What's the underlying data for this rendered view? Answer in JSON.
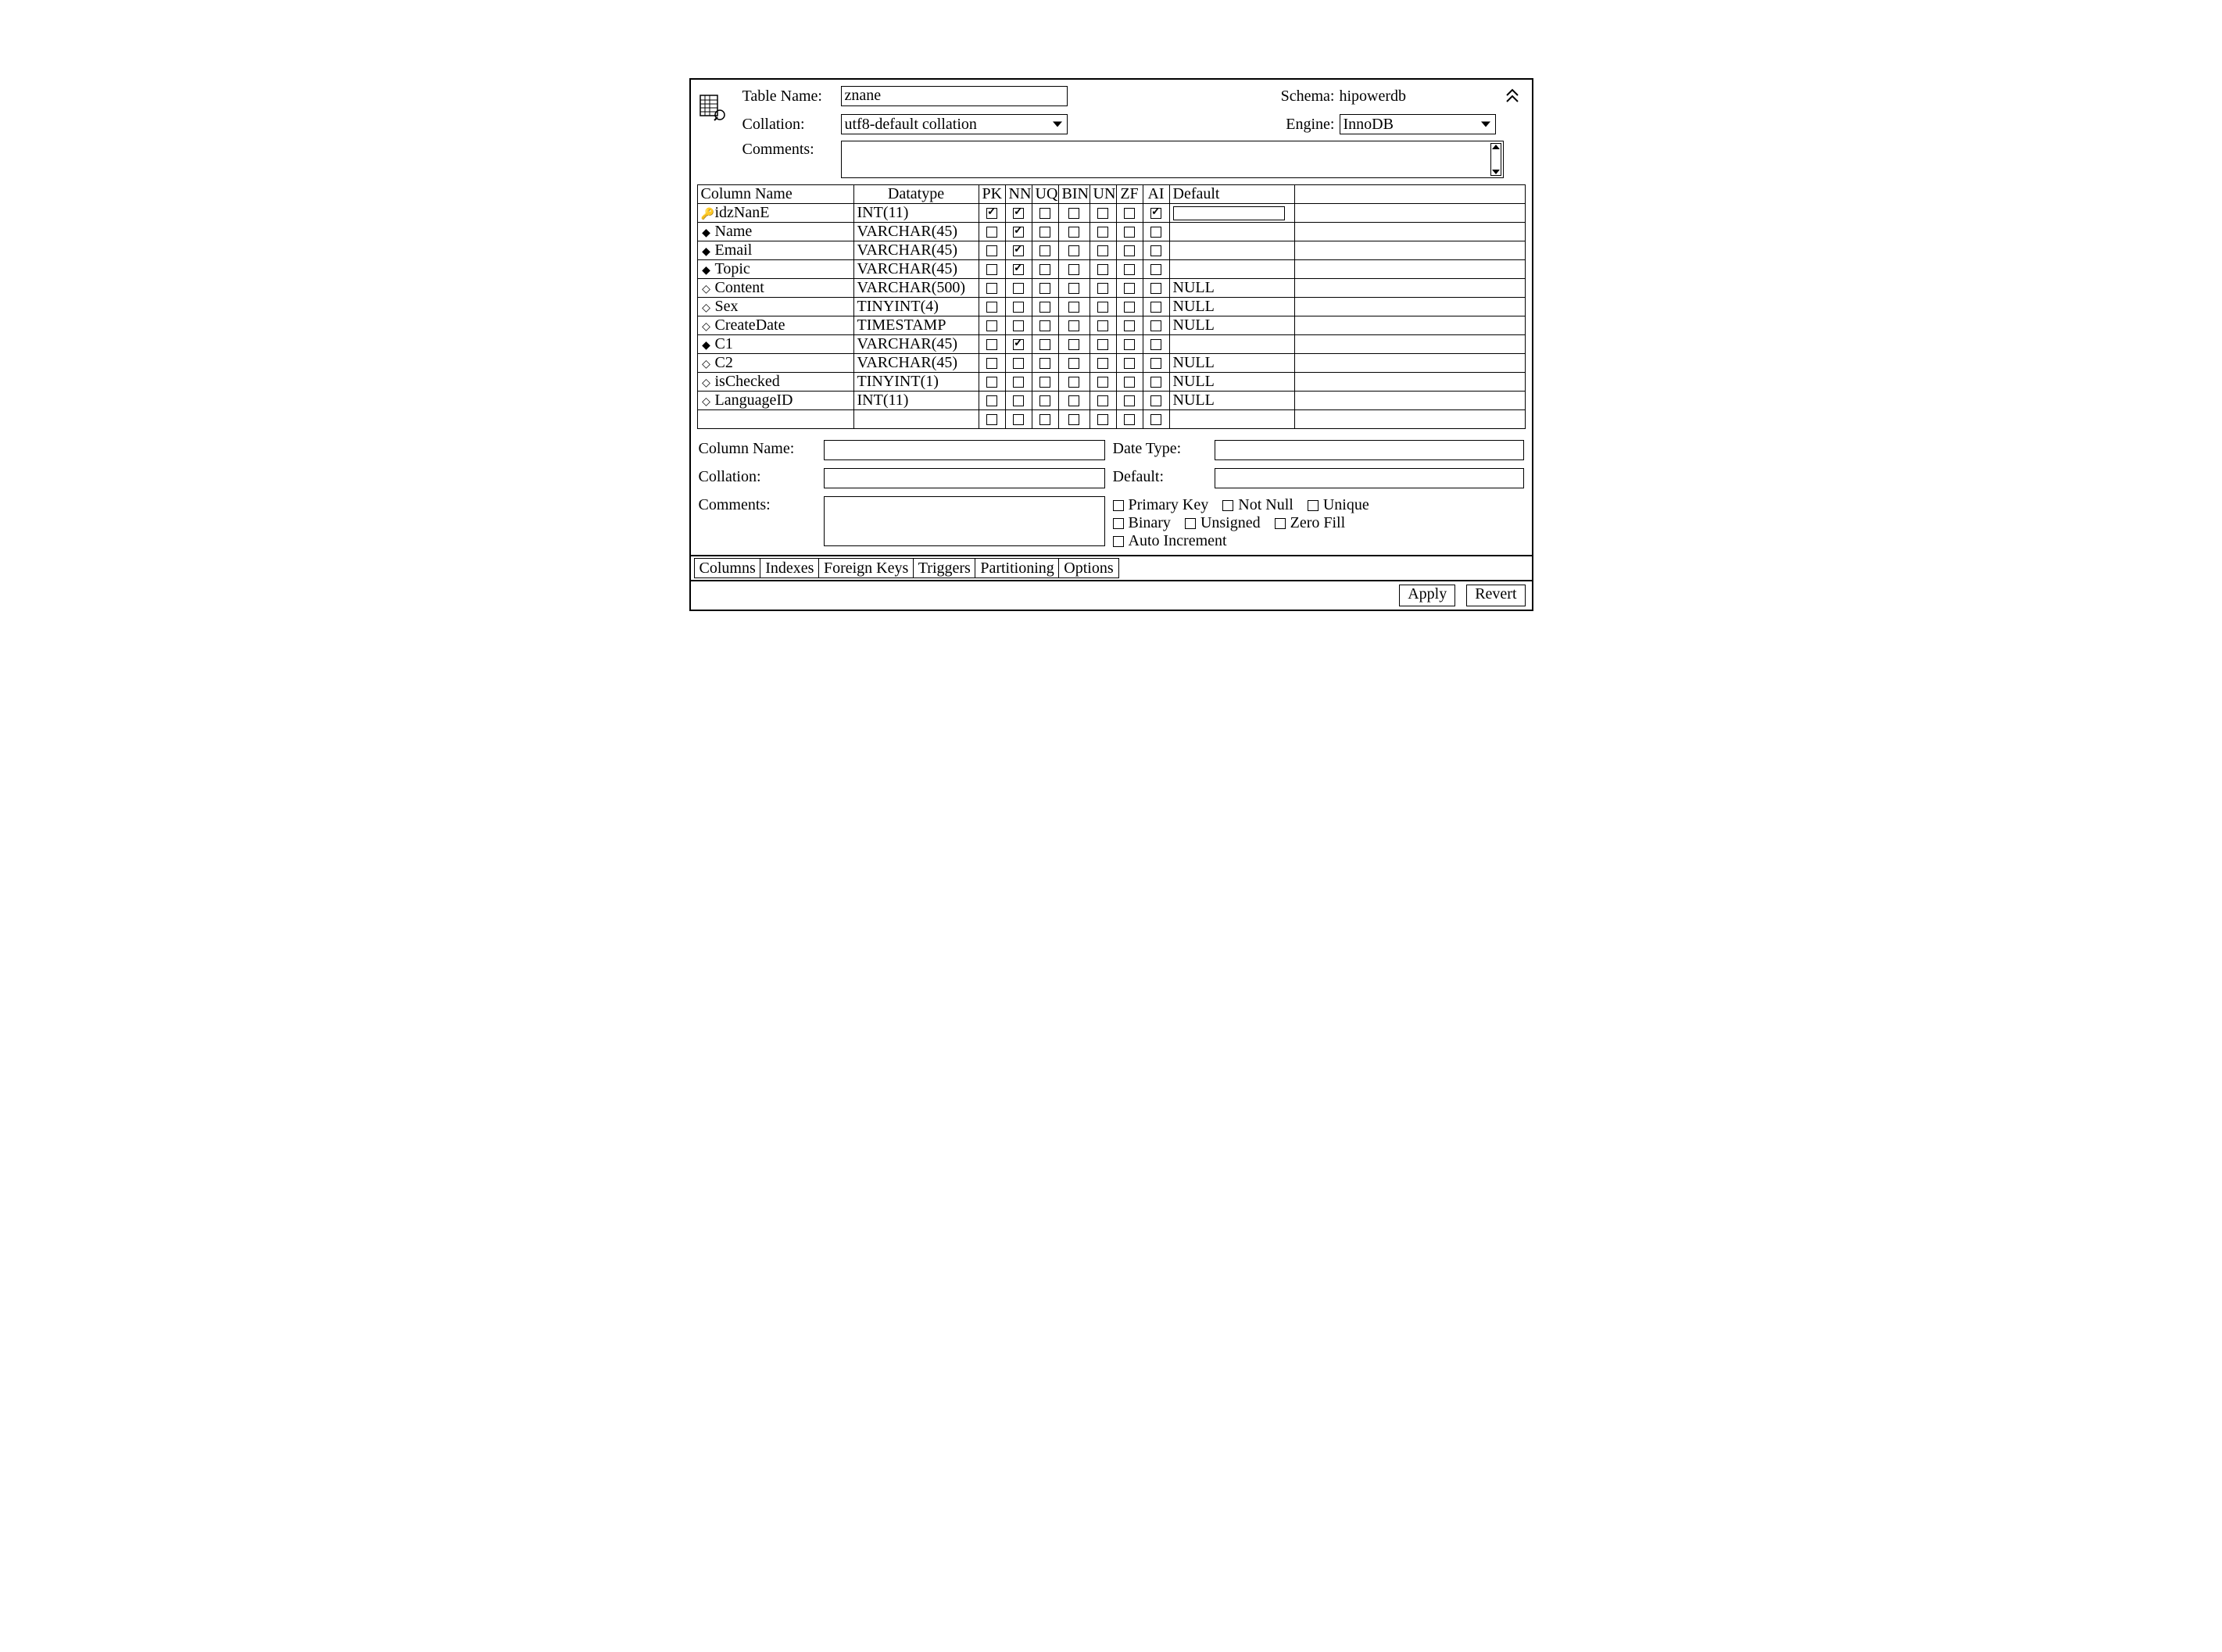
{
  "header": {
    "table_name_label": "Table Name:",
    "table_name_value": "znane",
    "schema_label": "Schema:",
    "schema_value": "hipowerdb",
    "collation_label": "Collation:",
    "collation_value": "utf8-default collation",
    "engine_label": "Engine:",
    "engine_value": "InnoDB",
    "comments_label": "Comments:",
    "comments_value": ""
  },
  "columns_table": {
    "headers": {
      "name": "Column Name",
      "datatype": "Datatype",
      "pk": "PK",
      "nn": "NN",
      "uq": "UQ",
      "bin": "BIN",
      "un": "UN",
      "zf": "ZF",
      "ai": "AI",
      "default": "Default"
    },
    "rows": [
      {
        "icon": "key",
        "name": "idzNanE",
        "datatype": "INT(11)",
        "pk": true,
        "nn": true,
        "uq": false,
        "bin": false,
        "un": false,
        "zf": false,
        "ai": true,
        "default": "",
        "default_is_input": true
      },
      {
        "icon": "filled",
        "name": "Name",
        "datatype": "VARCHAR(45)",
        "pk": false,
        "nn": true,
        "uq": false,
        "bin": false,
        "un": false,
        "zf": false,
        "ai": false,
        "default": ""
      },
      {
        "icon": "filled",
        "name": "Email",
        "datatype": "VARCHAR(45)",
        "pk": false,
        "nn": true,
        "uq": false,
        "bin": false,
        "un": false,
        "zf": false,
        "ai": false,
        "default": ""
      },
      {
        "icon": "filled",
        "name": "Topic",
        "datatype": "VARCHAR(45)",
        "pk": false,
        "nn": true,
        "uq": false,
        "bin": false,
        "un": false,
        "zf": false,
        "ai": false,
        "default": ""
      },
      {
        "icon": "hollow",
        "name": "Content",
        "datatype": "VARCHAR(500)",
        "pk": false,
        "nn": false,
        "uq": false,
        "bin": false,
        "un": false,
        "zf": false,
        "ai": false,
        "default": "NULL"
      },
      {
        "icon": "hollow",
        "name": "Sex",
        "datatype": "TINYINT(4)",
        "pk": false,
        "nn": false,
        "uq": false,
        "bin": false,
        "un": false,
        "zf": false,
        "ai": false,
        "default": "NULL"
      },
      {
        "icon": "hollow",
        "name": "CreateDate",
        "datatype": "TIMESTAMP",
        "pk": false,
        "nn": false,
        "uq": false,
        "bin": false,
        "un": false,
        "zf": false,
        "ai": false,
        "default": "NULL"
      },
      {
        "icon": "filled",
        "name": "C1",
        "datatype": "VARCHAR(45)",
        "pk": false,
        "nn": true,
        "uq": false,
        "bin": false,
        "un": false,
        "zf": false,
        "ai": false,
        "default": ""
      },
      {
        "icon": "hollow",
        "name": "C2",
        "datatype": "VARCHAR(45)",
        "pk": false,
        "nn": false,
        "uq": false,
        "bin": false,
        "un": false,
        "zf": false,
        "ai": false,
        "default": "NULL"
      },
      {
        "icon": "hollow",
        "name": "isChecked",
        "datatype": "TINYINT(1)",
        "pk": false,
        "nn": false,
        "uq": false,
        "bin": false,
        "un": false,
        "zf": false,
        "ai": false,
        "default": "NULL"
      },
      {
        "icon": "hollow",
        "name": "LanguageID",
        "datatype": "INT(11)",
        "pk": false,
        "nn": false,
        "uq": false,
        "bin": false,
        "un": false,
        "zf": false,
        "ai": false,
        "default": "NULL"
      },
      {
        "icon": "",
        "name": "",
        "datatype": "",
        "pk": false,
        "nn": false,
        "uq": false,
        "bin": false,
        "un": false,
        "zf": false,
        "ai": false,
        "default": ""
      }
    ]
  },
  "detail": {
    "column_name_label": "Column Name:",
    "column_name_value": "",
    "date_type_label": "Date Type:",
    "date_type_value": "",
    "collation_label": "Collation:",
    "collation_value": "",
    "default_label": "Default:",
    "default_value": "",
    "comments_label": "Comments:",
    "comments_value": "",
    "flags": {
      "primary_key": "Primary Key",
      "not_null": "Not Null",
      "unique": "Unique",
      "binary": "Binary",
      "unsigned": "Unsigned",
      "zero_fill": "Zero Fill",
      "auto_increment": "Auto Increment"
    }
  },
  "tabs": [
    "Columns",
    "Indexes",
    "Foreign Keys",
    "Triggers",
    "Partitioning",
    "Options"
  ],
  "footer": {
    "apply": "Apply",
    "revert": "Revert"
  }
}
